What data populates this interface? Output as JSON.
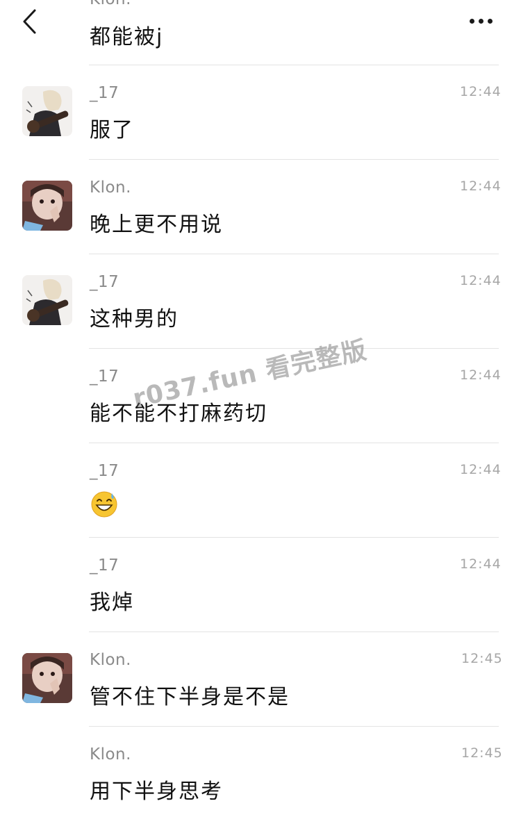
{
  "header": {
    "back_icon": "chevron-left-icon",
    "more_icon": "ellipsis-icon"
  },
  "top_partial": {
    "sender": "Klon.",
    "text": "都能被j"
  },
  "messages": [
    {
      "sender": "_17",
      "time": "12:44",
      "text": "服了",
      "avatar": "anime-guitar-avatar"
    },
    {
      "sender": "Klon.",
      "time": "12:44",
      "text": "晚上更不用说",
      "avatar": "girl-photo-avatar"
    },
    {
      "sender": "_17",
      "time": "12:44",
      "text": "这种男的",
      "avatar": "anime-guitar-avatar"
    },
    {
      "sender": "_17",
      "time": "12:44",
      "text": "能不能不打麻药切"
    },
    {
      "sender": "_17",
      "time": "12:44",
      "text": "",
      "emoji": "grinning-sweat-emoji"
    },
    {
      "sender": "_17",
      "time": "12:44",
      "text": "我焯"
    },
    {
      "sender": "Klon.",
      "time": "12:45",
      "text": "管不住下半身是不是",
      "avatar": "girl-photo-avatar"
    },
    {
      "sender": "Klon.",
      "time": "12:45",
      "text": "用下半身思考"
    }
  ],
  "watermark": "r037.fun 看完整版"
}
